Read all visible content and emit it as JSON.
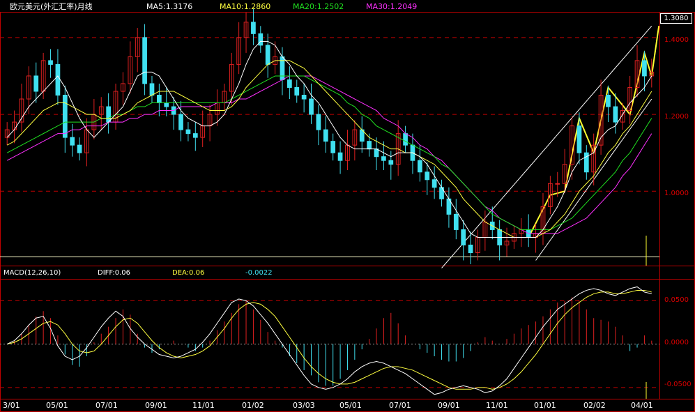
{
  "header": {
    "title": "欧元美元(外汇汇率)月线",
    "ma5": "MA5:1.3176",
    "ma10": "MA10:1.2860",
    "ma20": "MA20:1.2502",
    "ma30": "MA30:1.2049",
    "current_price": "1.3080"
  },
  "macd_header": {
    "label": "MACD(12,26,10)",
    "diff": "DIFF:0.06",
    "dea": "DEA:0.06",
    "value": "-0.0022"
  },
  "colors": {
    "background": "#000000",
    "up_candle": "#e02020",
    "down_candle": "#40e0f0",
    "ma5": "#ffffff",
    "ma10": "#ffff40",
    "ma20": "#20e020",
    "ma30": "#ff30ff",
    "grid": "#c00000",
    "frame": "#c00000",
    "trend_zigzag": "#ffff30",
    "channel": "#ffffff"
  },
  "chart_data": [
    {
      "type": "candlestick",
      "title": "欧元美元(外汇汇率)月线",
      "period": "monthly",
      "y_ticks": [
        "1.4000",
        "1.2000",
        "1.0000"
      ],
      "ylim": [
        0.83,
        1.465
      ],
      "x_ticks": [
        "3/01",
        "05/01",
        "07/01",
        "09/01",
        "11/01",
        "01/02",
        "03/03",
        "05/01",
        "07/01",
        "09/01",
        "11/01",
        "01/01",
        "02/02",
        "04/01"
      ],
      "close": [
        1.16,
        1.18,
        1.24,
        1.3,
        1.26,
        1.34,
        1.33,
        1.25,
        1.14,
        1.12,
        1.1,
        1.16,
        1.2,
        1.22,
        1.18,
        1.26,
        1.28,
        1.35,
        1.4,
        1.28,
        1.25,
        1.23,
        1.22,
        1.2,
        1.16,
        1.15,
        1.14,
        1.17,
        1.2,
        1.23,
        1.26,
        1.33,
        1.4,
        1.44,
        1.41,
        1.38,
        1.33,
        1.35,
        1.29,
        1.27,
        1.25,
        1.24,
        1.2,
        1.16,
        1.13,
        1.1,
        1.08,
        1.12,
        1.16,
        1.13,
        1.11,
        1.09,
        1.08,
        1.07,
        1.15,
        1.12,
        1.08,
        1.05,
        1.03,
        1.01,
        0.98,
        0.94,
        0.9,
        0.86,
        0.84,
        0.88,
        0.92,
        0.9,
        0.86,
        0.87,
        0.89,
        0.9,
        0.88,
        0.89,
        0.96,
        1.02,
        1.02,
        1.07,
        1.17,
        1.1,
        1.05,
        1.12,
        1.25,
        1.22,
        1.18,
        1.21,
        1.27,
        1.34,
        1.3,
        1.31
      ],
      "ma5": [
        1.14,
        1.16,
        1.19,
        1.22,
        1.24,
        1.26,
        1.28,
        1.3,
        1.27,
        1.23,
        1.19,
        1.16,
        1.14,
        1.16,
        1.18,
        1.2,
        1.22,
        1.26,
        1.3,
        1.31,
        1.31,
        1.3,
        1.27,
        1.24,
        1.21,
        1.19,
        1.18,
        1.17,
        1.17,
        1.18,
        1.2,
        1.24,
        1.28,
        1.33,
        1.37,
        1.39,
        1.39,
        1.38,
        1.35,
        1.33,
        1.3,
        1.28,
        1.25,
        1.23,
        1.2,
        1.17,
        1.14,
        1.12,
        1.11,
        1.11,
        1.11,
        1.11,
        1.1,
        1.09,
        1.1,
        1.1,
        1.1,
        1.09,
        1.07,
        1.04,
        1.01,
        0.98,
        0.95,
        0.92,
        0.89,
        0.88,
        0.88,
        0.88,
        0.88,
        0.88,
        0.88,
        0.88,
        0.88,
        0.88,
        0.9,
        0.93,
        0.96,
        1.0,
        1.05,
        1.08,
        1.09,
        1.1,
        1.14,
        1.16,
        1.17,
        1.2,
        1.23,
        1.25,
        1.27,
        1.3
      ],
      "ma10": [
        1.12,
        1.13,
        1.15,
        1.17,
        1.19,
        1.21,
        1.22,
        1.23,
        1.23,
        1.22,
        1.21,
        1.2,
        1.2,
        1.19,
        1.19,
        1.19,
        1.2,
        1.21,
        1.23,
        1.24,
        1.25,
        1.26,
        1.26,
        1.26,
        1.25,
        1.24,
        1.23,
        1.22,
        1.21,
        1.21,
        1.21,
        1.22,
        1.24,
        1.27,
        1.29,
        1.31,
        1.33,
        1.34,
        1.34,
        1.34,
        1.33,
        1.32,
        1.3,
        1.28,
        1.26,
        1.24,
        1.22,
        1.2,
        1.18,
        1.16,
        1.14,
        1.13,
        1.12,
        1.11,
        1.11,
        1.1,
        1.1,
        1.09,
        1.08,
        1.07,
        1.05,
        1.03,
        1.01,
        0.98,
        0.96,
        0.94,
        0.92,
        0.91,
        0.9,
        0.89,
        0.88,
        0.88,
        0.88,
        0.88,
        0.89,
        0.9,
        0.92,
        0.94,
        0.97,
        1.0,
        1.02,
        1.04,
        1.07,
        1.1,
        1.12,
        1.15,
        1.17,
        1.2,
        1.23,
        1.26
      ],
      "ma20": [
        1.1,
        1.11,
        1.12,
        1.13,
        1.14,
        1.15,
        1.16,
        1.17,
        1.18,
        1.18,
        1.18,
        1.18,
        1.18,
        1.19,
        1.19,
        1.2,
        1.2,
        1.21,
        1.22,
        1.22,
        1.23,
        1.23,
        1.23,
        1.23,
        1.23,
        1.23,
        1.23,
        1.23,
        1.23,
        1.23,
        1.23,
        1.24,
        1.25,
        1.26,
        1.27,
        1.28,
        1.29,
        1.3,
        1.3,
        1.3,
        1.3,
        1.3,
        1.29,
        1.28,
        1.27,
        1.26,
        1.25,
        1.23,
        1.22,
        1.2,
        1.19,
        1.17,
        1.16,
        1.15,
        1.14,
        1.13,
        1.12,
        1.11,
        1.1,
        1.09,
        1.07,
        1.06,
        1.04,
        1.02,
        1.0,
        0.98,
        0.96,
        0.94,
        0.93,
        0.92,
        0.91,
        0.9,
        0.9,
        0.9,
        0.9,
        0.9,
        0.91,
        0.92,
        0.93,
        0.95,
        0.97,
        0.99,
        1.01,
        1.03,
        1.05,
        1.08,
        1.1,
        1.13,
        1.16,
        1.19
      ],
      "ma30": [
        1.08,
        1.09,
        1.1,
        1.11,
        1.12,
        1.13,
        1.14,
        1.15,
        1.15,
        1.16,
        1.16,
        1.17,
        1.17,
        1.17,
        1.18,
        1.18,
        1.18,
        1.19,
        1.19,
        1.2,
        1.2,
        1.21,
        1.21,
        1.21,
        1.22,
        1.22,
        1.22,
        1.22,
        1.22,
        1.23,
        1.23,
        1.23,
        1.24,
        1.24,
        1.25,
        1.26,
        1.27,
        1.28,
        1.29,
        1.3,
        1.3,
        1.3,
        1.3,
        1.29,
        1.28,
        1.27,
        1.26,
        1.25,
        1.24,
        1.23,
        1.22,
        1.21,
        1.19,
        1.18,
        1.17,
        1.15,
        1.14,
        1.12,
        1.11,
        1.09,
        1.08,
        1.06,
        1.04,
        1.02,
        1.0,
        0.98,
        0.96,
        0.95,
        0.93,
        0.92,
        0.91,
        0.9,
        0.89,
        0.89,
        0.89,
        0.89,
        0.89,
        0.9,
        0.91,
        0.92,
        0.93,
        0.95,
        0.97,
        0.99,
        1.01,
        1.04,
        1.06,
        1.09,
        1.12,
        1.15
      ]
    },
    {
      "type": "macd",
      "title": "MACD(12,26,10)",
      "y_ticks": [
        "0.0500",
        "0.0000",
        "-0.0500"
      ],
      "ylim": [
        -0.063,
        0.072
      ],
      "x_ticks": [
        "3/01",
        "05/01",
        "07/01",
        "09/01",
        "11/01",
        "01/02",
        "03/03",
        "05/01",
        "07/01",
        "09/01",
        "11/01",
        "01/01",
        "02/02",
        "04/01"
      ],
      "hist": [
        0.0,
        0.004,
        0.012,
        0.022,
        0.032,
        0.038,
        0.03,
        0.01,
        -0.012,
        -0.024,
        -0.026,
        -0.014,
        0.002,
        0.012,
        0.02,
        0.03,
        0.04,
        0.034,
        0.012,
        -0.004,
        -0.01,
        -0.006,
        0.0,
        0.004,
        0.0,
        -0.004,
        -0.008,
        -0.004,
        0.004,
        0.016,
        0.026,
        0.036,
        0.046,
        0.05,
        0.04,
        0.028,
        0.014,
        0.004,
        -0.004,
        -0.014,
        -0.022,
        -0.03,
        -0.036,
        -0.044,
        -0.048,
        -0.048,
        -0.04,
        -0.03,
        -0.018,
        -0.006,
        0.006,
        0.018,
        0.03,
        0.036,
        0.024,
        0.01,
        0.0,
        -0.006,
        -0.01,
        -0.014,
        -0.018,
        -0.02,
        -0.02,
        -0.016,
        -0.008,
        0.002,
        0.008,
        0.004,
        0.0,
        0.006,
        0.012,
        0.018,
        0.022,
        0.026,
        0.032,
        0.04,
        0.048,
        0.05,
        0.054,
        0.05,
        0.04,
        0.03,
        0.028,
        0.026,
        0.02,
        0.01,
        -0.008,
        -0.004,
        0.01,
        0.004
      ],
      "diff": [
        0.0,
        0.004,
        0.012,
        0.022,
        0.03,
        0.032,
        0.018,
        -0.002,
        -0.014,
        -0.018,
        -0.014,
        -0.004,
        0.008,
        0.02,
        0.03,
        0.038,
        0.032,
        0.018,
        0.008,
        0.0,
        -0.006,
        -0.012,
        -0.014,
        -0.016,
        -0.014,
        -0.01,
        -0.006,
        0.002,
        0.012,
        0.024,
        0.036,
        0.048,
        0.052,
        0.05,
        0.044,
        0.034,
        0.024,
        0.012,
        0.0,
        -0.012,
        -0.024,
        -0.036,
        -0.046,
        -0.05,
        -0.052,
        -0.05,
        -0.046,
        -0.04,
        -0.032,
        -0.026,
        -0.022,
        -0.02,
        -0.022,
        -0.026,
        -0.03,
        -0.034,
        -0.04,
        -0.046,
        -0.052,
        -0.058,
        -0.056,
        -0.052,
        -0.05,
        -0.048,
        -0.05,
        -0.052,
        -0.056,
        -0.054,
        -0.048,
        -0.04,
        -0.028,
        -0.016,
        -0.004,
        0.008,
        0.02,
        0.03,
        0.04,
        0.046,
        0.052,
        0.058,
        0.062,
        0.064,
        0.062,
        0.058,
        0.056,
        0.06,
        0.064,
        0.066,
        0.06,
        0.058
      ],
      "dea": [
        0.0,
        0.002,
        0.006,
        0.012,
        0.018,
        0.024,
        0.026,
        0.022,
        0.012,
        0.0,
        -0.008,
        -0.01,
        -0.008,
        0.0,
        0.01,
        0.02,
        0.028,
        0.03,
        0.024,
        0.014,
        0.004,
        -0.004,
        -0.01,
        -0.014,
        -0.016,
        -0.014,
        -0.012,
        -0.008,
        -0.002,
        0.008,
        0.018,
        0.03,
        0.04,
        0.046,
        0.048,
        0.046,
        0.04,
        0.032,
        0.02,
        0.008,
        -0.004,
        -0.016,
        -0.026,
        -0.034,
        -0.04,
        -0.044,
        -0.046,
        -0.046,
        -0.044,
        -0.04,
        -0.036,
        -0.032,
        -0.028,
        -0.026,
        -0.026,
        -0.028,
        -0.03,
        -0.034,
        -0.038,
        -0.042,
        -0.046,
        -0.05,
        -0.052,
        -0.052,
        -0.052,
        -0.05,
        -0.05,
        -0.052,
        -0.05,
        -0.046,
        -0.04,
        -0.032,
        -0.022,
        -0.012,
        0.0,
        0.012,
        0.024,
        0.034,
        0.042,
        0.048,
        0.054,
        0.058,
        0.06,
        0.06,
        0.058,
        0.058,
        0.06,
        0.062,
        0.062,
        0.06
      ]
    }
  ]
}
